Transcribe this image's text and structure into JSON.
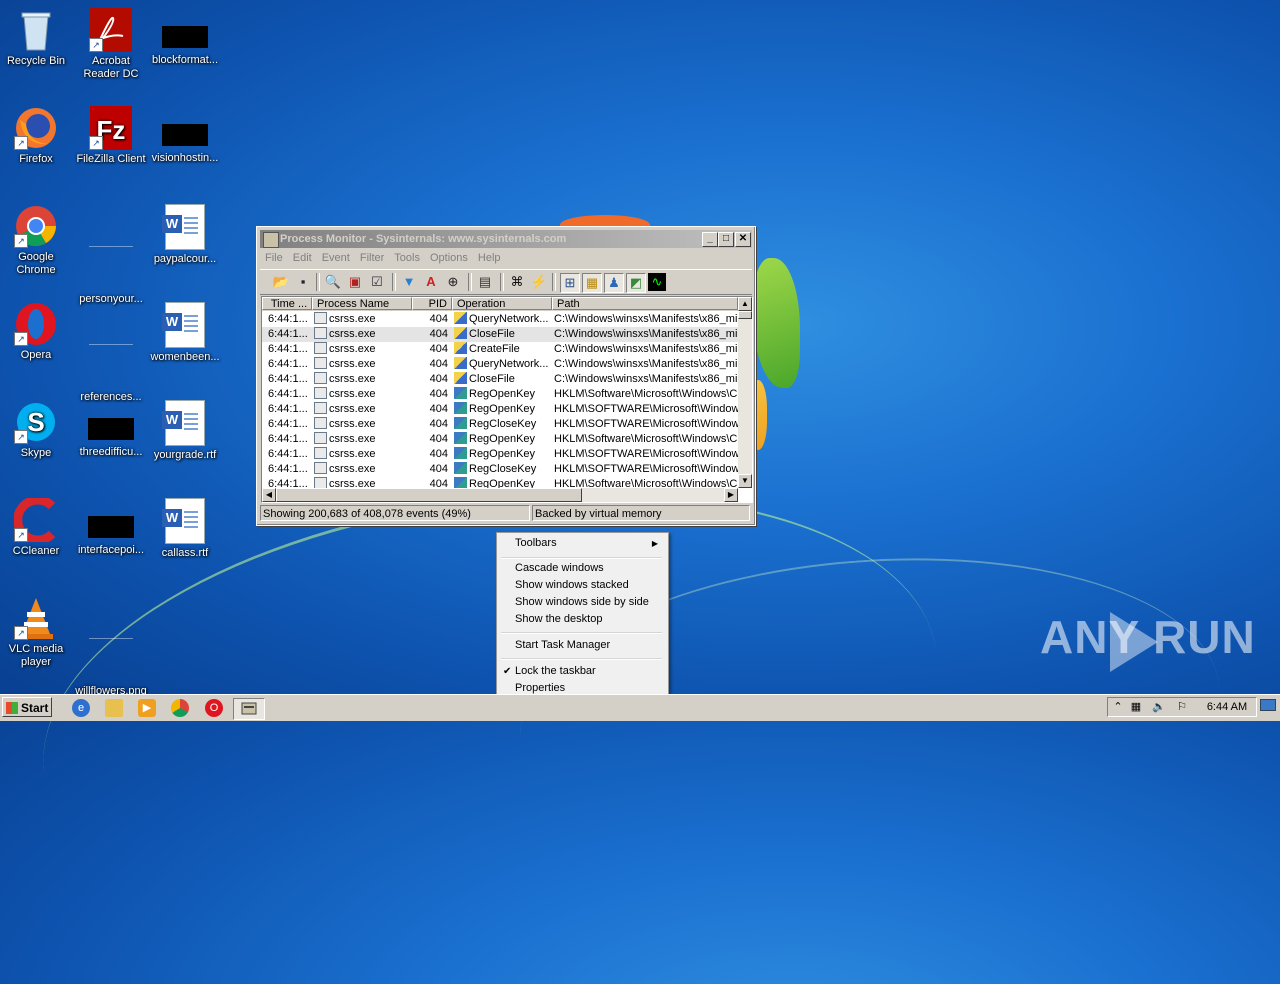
{
  "desktop": {
    "icons": [
      {
        "label": "Recycle Bin"
      },
      {
        "label": "Acrobat Reader DC"
      },
      {
        "label": "blockformat..."
      },
      {
        "label": "Firefox"
      },
      {
        "label": "FileZilla Client"
      },
      {
        "label": "visionhostin..."
      },
      {
        "label": "Google Chrome"
      },
      {
        "label": "personyour..."
      },
      {
        "label": "paypalcour..."
      },
      {
        "label": "Opera"
      },
      {
        "label": "references..."
      },
      {
        "label": "womenbeen..."
      },
      {
        "label": "Skype"
      },
      {
        "label": "threedifficu..."
      },
      {
        "label": "yourgrade.rtf"
      },
      {
        "label": "CCleaner"
      },
      {
        "label": "interfacepoi..."
      },
      {
        "label": "callass.rtf"
      },
      {
        "label": "VLC media player"
      },
      {
        "label": "willflowers.png"
      }
    ]
  },
  "procmon": {
    "title": "Process Monitor - Sysinternals: www.sysinternals.com",
    "menu": [
      "File",
      "Edit",
      "Event",
      "Filter",
      "Tools",
      "Options",
      "Help"
    ],
    "columns": [
      "Time ...",
      "Process Name",
      "PID",
      "Operation",
      "Path"
    ],
    "rows": [
      {
        "time": "6:44:1...",
        "process": "csrss.exe",
        "pid": "404",
        "op": "QueryNetwork...",
        "path": "C:\\Windows\\winsxs\\Manifests\\x86_mi",
        "kind": "file"
      },
      {
        "time": "6:44:1...",
        "process": "csrss.exe",
        "pid": "404",
        "op": "CloseFile",
        "path": "C:\\Windows\\winsxs\\Manifests\\x86_mi",
        "kind": "file"
      },
      {
        "time": "6:44:1...",
        "process": "csrss.exe",
        "pid": "404",
        "op": "CreateFile",
        "path": "C:\\Windows\\winsxs\\Manifests\\x86_mi",
        "kind": "file"
      },
      {
        "time": "6:44:1...",
        "process": "csrss.exe",
        "pid": "404",
        "op": "QueryNetwork...",
        "path": "C:\\Windows\\winsxs\\Manifests\\x86_mi",
        "kind": "file"
      },
      {
        "time": "6:44:1...",
        "process": "csrss.exe",
        "pid": "404",
        "op": "CloseFile",
        "path": "C:\\Windows\\winsxs\\Manifests\\x86_mi",
        "kind": "file"
      },
      {
        "time": "6:44:1...",
        "process": "csrss.exe",
        "pid": "404",
        "op": "RegOpenKey",
        "path": "HKLM\\Software\\Microsoft\\Windows\\C",
        "kind": "reg"
      },
      {
        "time": "6:44:1...",
        "process": "csrss.exe",
        "pid": "404",
        "op": "RegOpenKey",
        "path": "HKLM\\SOFTWARE\\Microsoft\\Window",
        "kind": "reg"
      },
      {
        "time": "6:44:1...",
        "process": "csrss.exe",
        "pid": "404",
        "op": "RegCloseKey",
        "path": "HKLM\\SOFTWARE\\Microsoft\\Window",
        "kind": "reg"
      },
      {
        "time": "6:44:1...",
        "process": "csrss.exe",
        "pid": "404",
        "op": "RegOpenKey",
        "path": "HKLM\\Software\\Microsoft\\Windows\\C",
        "kind": "reg"
      },
      {
        "time": "6:44:1...",
        "process": "csrss.exe",
        "pid": "404",
        "op": "RegOpenKey",
        "path": "HKLM\\SOFTWARE\\Microsoft\\Window",
        "kind": "reg"
      },
      {
        "time": "6:44:1...",
        "process": "csrss.exe",
        "pid": "404",
        "op": "RegCloseKey",
        "path": "HKLM\\SOFTWARE\\Microsoft\\Window",
        "kind": "reg"
      },
      {
        "time": "6:44:1...",
        "process": "csrss.exe",
        "pid": "404",
        "op": "RegOpenKey",
        "path": "HKLM\\Software\\Microsoft\\Windows\\C",
        "kind": "reg"
      }
    ],
    "selected_row": 1,
    "status_events": "Showing 200,683 of 408,078 events (49%)",
    "status_memory": "Backed by virtual memory"
  },
  "context_menu": {
    "toolbars": "Toolbars",
    "cascade": "Cascade windows",
    "stacked": "Show windows stacked",
    "side_by_side": "Show windows side by side",
    "show_desktop": "Show the desktop",
    "task_manager": "Start Task Manager",
    "lock_taskbar": "Lock the taskbar",
    "properties": "Properties"
  },
  "taskbar": {
    "start": "Start",
    "clock": "6:44 AM"
  },
  "watermark": "ANY RUN",
  "colors": {
    "accent": "#0d52ad",
    "titlebar_inactive": "#808080"
  }
}
